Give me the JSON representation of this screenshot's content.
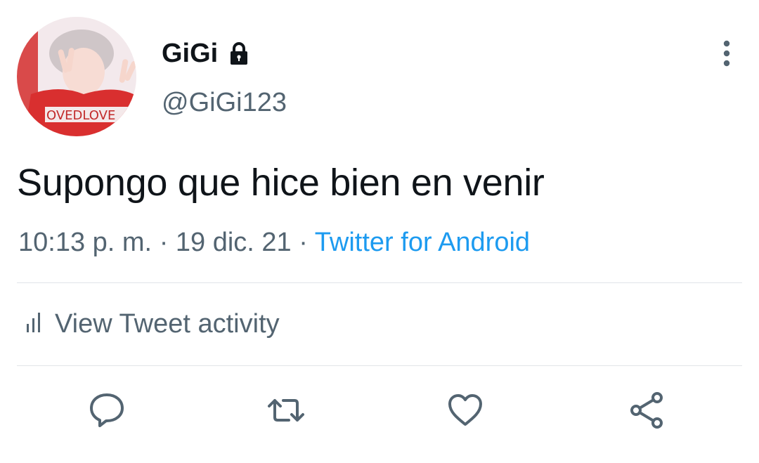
{
  "user": {
    "display_name": "GiGi",
    "handle": "@GiGi123",
    "avatar_shirt_text": "OVEDLOVE",
    "protected_icon": "lock-icon"
  },
  "tweet": {
    "text": "Supongo que hice bien en venir",
    "time": "10:13 p. m.",
    "separator": "·",
    "date": "19 dic. 21",
    "source": "Twitter for Android"
  },
  "activity": {
    "label": "View Tweet activity",
    "icon": "analytics-icon"
  },
  "actions": [
    {
      "icon": "reply-icon"
    },
    {
      "icon": "retweet-icon"
    },
    {
      "icon": "like-icon"
    },
    {
      "icon": "share-icon"
    }
  ],
  "menu_icon": "more-vertical-icon",
  "colors": {
    "text_primary": "#0f1419",
    "text_secondary": "#536471",
    "link": "#1d9bf0",
    "divider": "#e1e4e8"
  }
}
